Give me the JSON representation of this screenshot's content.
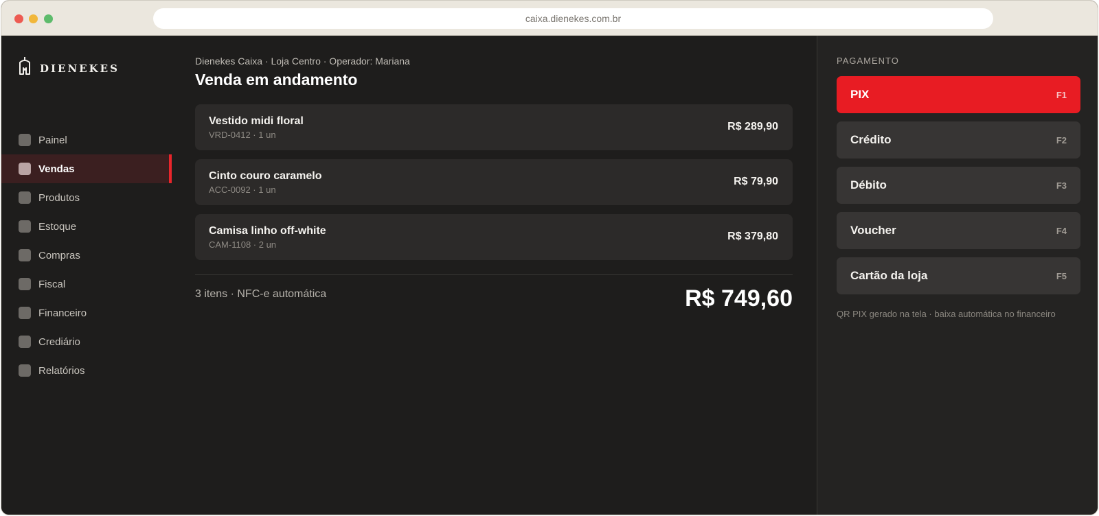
{
  "browser": {
    "url": "caixa.dienekes.com.br"
  },
  "brand": {
    "name": "DIENEKES"
  },
  "sidebar": {
    "items": [
      {
        "label": "Painel"
      },
      {
        "label": "Vendas",
        "active": true
      },
      {
        "label": "Produtos"
      },
      {
        "label": "Estoque"
      },
      {
        "label": "Compras"
      },
      {
        "label": "Fiscal"
      },
      {
        "label": "Financeiro"
      },
      {
        "label": "Crediário"
      },
      {
        "label": "Relatórios"
      }
    ]
  },
  "main": {
    "breadcrumb": "Dienekes Caixa · Loja Centro · Operador: Mariana",
    "title": "Venda em andamento",
    "items": [
      {
        "name": "Vestido midi floral",
        "sub": "VRD-0412 · 1 un",
        "price": "R$ 289,90"
      },
      {
        "name": "Cinto couro caramelo",
        "sub": "ACC-0092 · 1 un",
        "price": "R$ 79,90"
      },
      {
        "name": "Camisa linho off-white",
        "sub": "CAM-1108 · 2 un",
        "price": "R$ 379,80"
      }
    ],
    "summary": "3 itens · NFC-e automática",
    "total": "R$ 749,60"
  },
  "payment": {
    "heading": "PAGAMENTO",
    "methods": [
      {
        "label": "PIX",
        "key": "F1",
        "selected": true
      },
      {
        "label": "Crédito",
        "key": "F2"
      },
      {
        "label": "Débito",
        "key": "F3"
      },
      {
        "label": "Voucher",
        "key": "F4"
      },
      {
        "label": "Cartão da loja",
        "key": "F5"
      }
    ],
    "note": "QR PIX gerado na tela · baixa automática no financeiro"
  },
  "colors": {
    "accent": "#e81c23",
    "background": "#1e1d1c",
    "card": "#2c2a29"
  }
}
